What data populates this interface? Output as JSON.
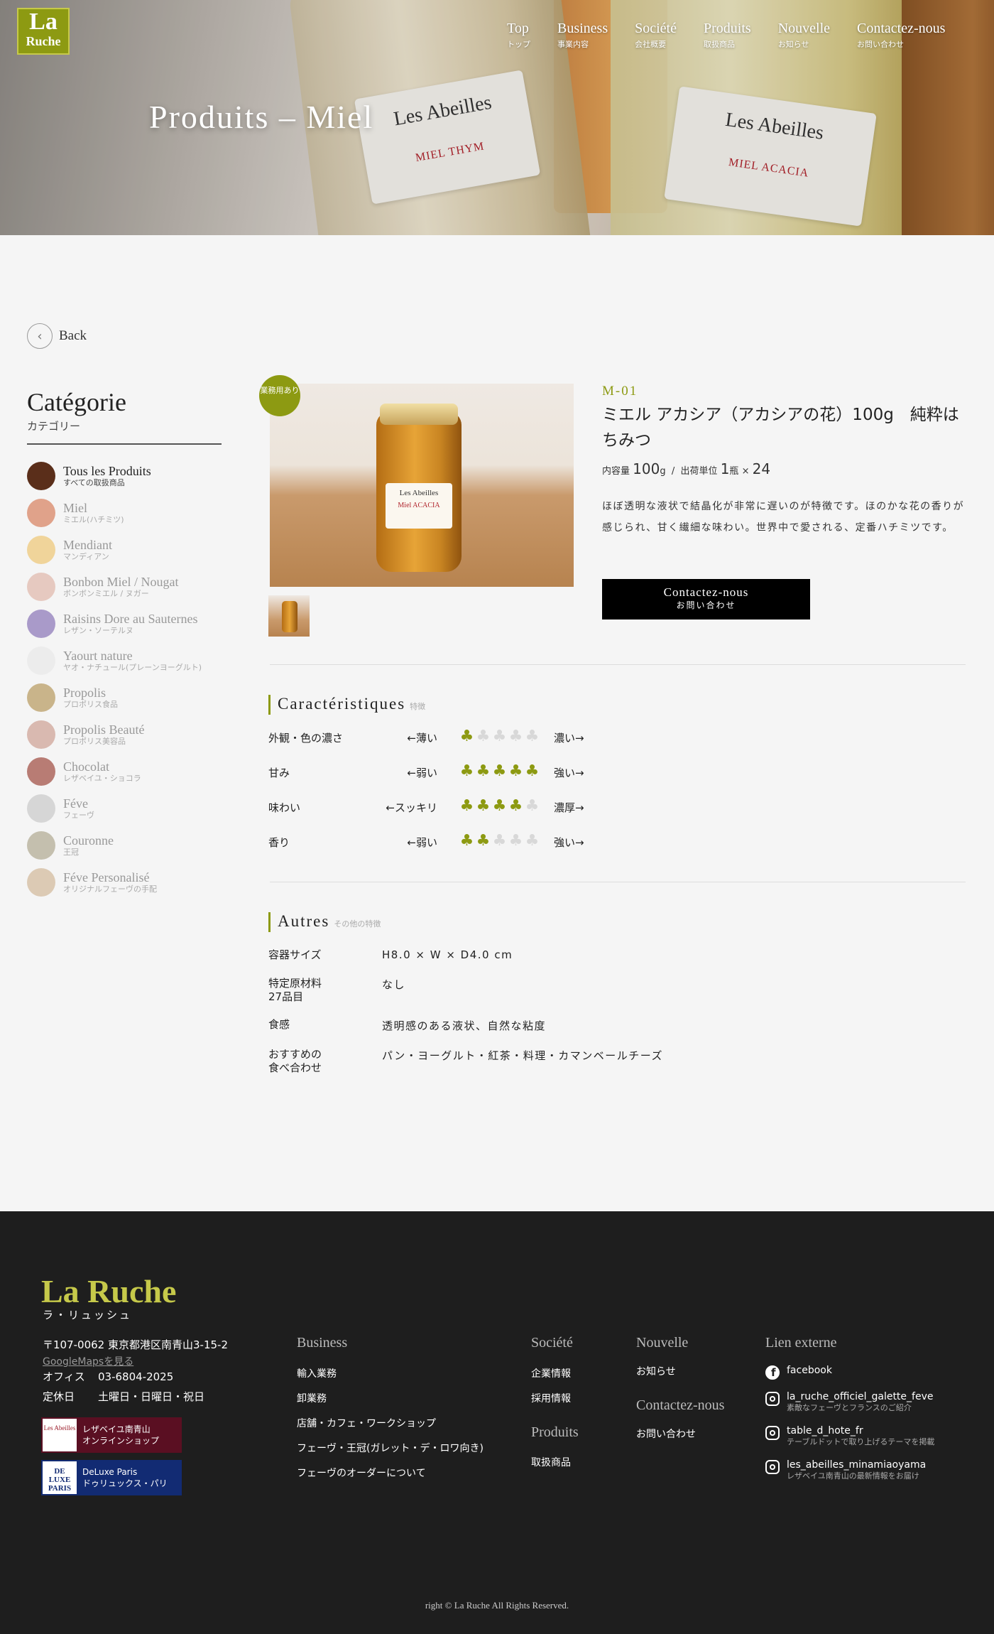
{
  "brand": {
    "logo_top": "La",
    "logo_bottom": "Ruche"
  },
  "nav": [
    {
      "en": "Top",
      "ja": "トップ"
    },
    {
      "en": "Business",
      "ja": "事業内容"
    },
    {
      "en": "Société",
      "ja": "会社概要"
    },
    {
      "en": "Produits",
      "ja": "取扱商品"
    },
    {
      "en": "Nouvelle",
      "ja": "お知らせ"
    },
    {
      "en": "Contactez-nous",
      "ja": "お問い合わせ"
    }
  ],
  "hero": {
    "title": "Produits – Miel",
    "label1_brand": "Les Abeilles",
    "label1_kind": "MIEL THYM",
    "label2_brand": "Les Abeilles",
    "label2_kind": "MIEL ACACIA"
  },
  "back_label": "Back",
  "sidebar": {
    "title": "Catégorie",
    "subtitle": "カテゴリー",
    "items": [
      {
        "en": "Tous les Produits",
        "ja": "すべての取扱商品",
        "color": "#5a2e1a"
      },
      {
        "en": "Miel",
        "ja": "ミエル(ハチミツ)",
        "color": "#e0a28a"
      },
      {
        "en": "Mendiant",
        "ja": "マンディアン",
        "color": "#f0d49a"
      },
      {
        "en": "Bonbon Miel / Nougat",
        "ja": "ボンボンミエル / ヌガー",
        "color": "#e6c9c0"
      },
      {
        "en": "Raisins Dore au Sauternes",
        "ja": "レザン・ソーテルヌ",
        "color": "#a99ac9"
      },
      {
        "en": "Yaourt nature",
        "ja": "ヤオ・ナチュール(プレーンヨーグルト)",
        "color": "#ececec"
      },
      {
        "en": "Propolis",
        "ja": "プロポリス食品",
        "color": "#c9b48a"
      },
      {
        "en": "Propolis Beauté",
        "ja": "プロポリス美容品",
        "color": "#d9b9b0"
      },
      {
        "en": "Chocolat",
        "ja": "レザベイユ・ショコラ",
        "color": "#b87c74"
      },
      {
        "en": "Féve",
        "ja": "フェーヴ",
        "color": "#d6d6d6"
      },
      {
        "en": "Couronne",
        "ja": "王冠",
        "color": "#c4bfae"
      },
      {
        "en": "Féve Personalisé",
        "ja": "オリジナルフェーヴの手配",
        "color": "#dccab4"
      }
    ]
  },
  "product": {
    "badge": "業務用あり",
    "image_label_brand": "Les Abeilles",
    "image_label_kind": "Miel ACACIA",
    "code": "M-01",
    "name": "ミエル アカシア（アカシアの花）100g　純粋はちみつ",
    "spec_prefix": "内容量",
    "spec_volume": "100",
    "spec_volume_unit": "g",
    "spec_sep": "/",
    "spec_unit_label": "出荷単位",
    "spec_unit_value": "1",
    "spec_unit_bottle": "瓶",
    "spec_times": "×",
    "spec_count": "24",
    "description": "ほぼ透明な液状で結晶化が非常に遅いのが特徴です。ほのかな花の香りが感じられ、甘く繊細な味わい。世界中で愛される、定番ハチミツです。",
    "contact_en": "Contactez-nous",
    "contact_ja": "お問い合わせ"
  },
  "characteristics": {
    "title_en": "Caractéristiques",
    "title_ja": "特徴",
    "rows": [
      {
        "label": "外観・色の濃さ",
        "low": "←薄い",
        "high": "濃い→",
        "rating": 1,
        "max": 5
      },
      {
        "label": "甘み",
        "low": "←弱い",
        "high": "強い→",
        "rating": 5,
        "max": 5
      },
      {
        "label": "味わい",
        "low": "←スッキリ",
        "high": "濃厚→",
        "rating": 4,
        "max": 5
      },
      {
        "label": "香り",
        "low": "←弱い",
        "high": "強い→",
        "rating": 2,
        "max": 5
      }
    ]
  },
  "others": {
    "title_en": "Autres",
    "title_ja": "その他の特徴",
    "rows": [
      {
        "key": "容器サイズ",
        "value": "H8.0 × W × D4.0 cm"
      },
      {
        "key": "特定原材料\n27品目",
        "value": "なし"
      },
      {
        "key": "食感",
        "value": "透明感のある液状、自然な粘度"
      },
      {
        "key": "おすすめの\n食べ合わせ",
        "value": "パン・ヨーグルト・紅茶・料理・カマンベールチーズ"
      }
    ]
  },
  "footer": {
    "logo": "La Ruche",
    "logo_sub": "ラ・リュッシュ",
    "address": "〒107-0062 東京都港区南青山3-15-2",
    "map_link": "GoogleMapsを見る",
    "office_label": "オフィス",
    "office_tel": "03-6804-2025",
    "closed_label": "定休日",
    "closed_days": "土曜日・日曜日・祝日",
    "shop1_icon": "Les Abeilles",
    "shop1_line1": "レザベイユ南青山",
    "shop1_line2": "オンラインショップ",
    "shop2_icon": "DE LUXE PARIS",
    "shop2_line1": "DeLuxe Paris",
    "shop2_line2": "ドゥリュックス・パリ",
    "business_title": "Business",
    "business_items": [
      "輸入業務",
      "卸業務",
      "店舗・カフェ・ワークショップ",
      "フェーヴ・王冠(ガレット・デ・ロワ向き)",
      "フェーヴのオーダーについて"
    ],
    "societe_title": "Société",
    "societe_items": [
      "企業情報",
      "採用情報"
    ],
    "produits_title": "Produits",
    "produits_items": [
      "取扱商品"
    ],
    "nouvelle_title": "Nouvelle",
    "nouvelle_items": [
      "お知らせ"
    ],
    "contact_title": "Contactez-nous",
    "contact_items": [
      "お問い合わせ"
    ],
    "lien_title": "Lien externe",
    "social": [
      {
        "name": "facebook",
        "desc": "",
        "icon": "facebook-icon"
      },
      {
        "name": "la_ruche_officiel_galette_feve",
        "desc": "素敵なフェーヴとフランスのご紹介",
        "icon": "instagram-icon"
      },
      {
        "name": "table_d_hote_fr",
        "desc": "テーブルドットで取り上げるテーマを掲載",
        "icon": "instagram-icon"
      },
      {
        "name": "les_abeilles_minamiaoyama",
        "desc": "レザベイユ南青山の最新情報をお届け",
        "icon": "instagram-icon"
      }
    ],
    "copyright": "right © La Ruche All Rights Reserved."
  },
  "colors": {
    "accent": "#8d9a12",
    "footer_bg": "#1e1e1e",
    "button_bg": "#000000"
  }
}
